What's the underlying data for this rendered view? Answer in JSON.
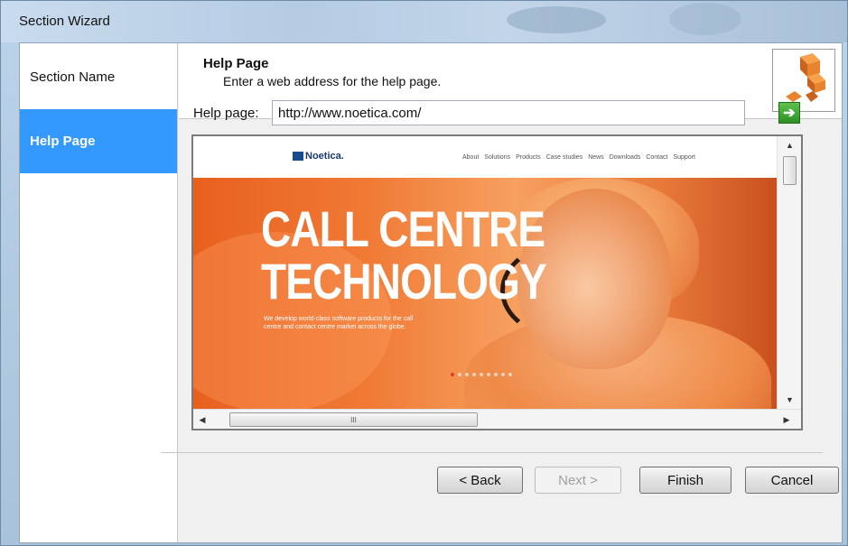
{
  "window": {
    "title": "Section Wizard"
  },
  "nav": {
    "items": [
      {
        "label": "Section Name",
        "selected": false
      },
      {
        "label": "Help Page",
        "selected": true
      }
    ]
  },
  "header": {
    "title": "Help Page",
    "subtitle": "Enter a web address for the help page.",
    "icon": "boxes-icon"
  },
  "form": {
    "help_label": "Help page:",
    "help_url": "http://www.noetica.com/",
    "go_icon": "go-arrow-icon"
  },
  "preview": {
    "logo_text": "Noetica.",
    "menu": [
      "About",
      "Solutions",
      "Products",
      "Case studies",
      "News",
      "Downloads",
      "Contact",
      "Support"
    ],
    "hero_line1": "CALL CENTRE",
    "hero_line2": "TECHNOLOGY",
    "hero_text": "We develop world-class software products for the call centre and contact centre market across the globe.",
    "hscroll_grip": "III"
  },
  "buttons": {
    "back": "< Back",
    "next": "Next >",
    "finish": "Finish",
    "cancel": "Cancel"
  },
  "colors": {
    "selection": "#3399ff",
    "hero_orange": "#f07a35"
  }
}
